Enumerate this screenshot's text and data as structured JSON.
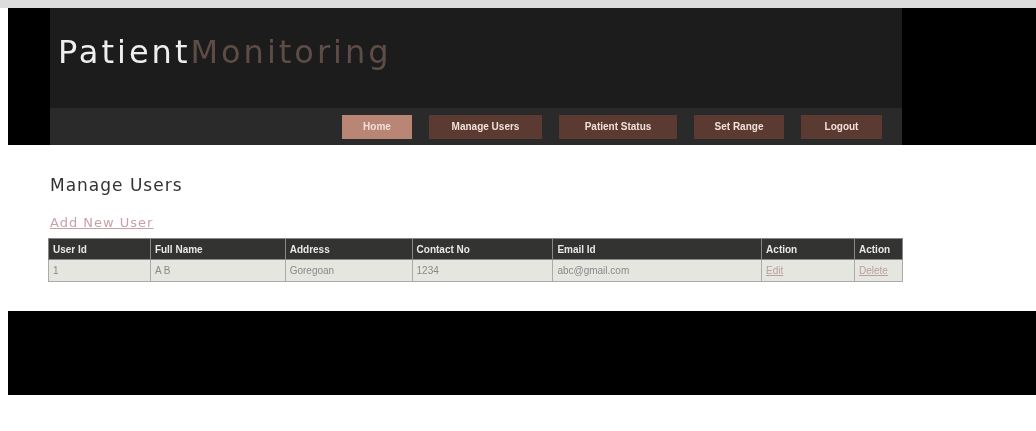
{
  "header": {
    "title_first": "Patient",
    "title_second": "Monitoring"
  },
  "nav": [
    {
      "label": "Home",
      "selected": true
    },
    {
      "label": "Manage Users",
      "selected": false
    },
    {
      "label": "Patient Status",
      "selected": false
    },
    {
      "label": "Set Range",
      "selected": false
    },
    {
      "label": "Logout",
      "selected": false
    }
  ],
  "page": {
    "heading": "Manage Users",
    "add_link": "Add New User"
  },
  "table": {
    "columns": [
      "User Id",
      "Full Name",
      "Address",
      "Contact No",
      "Email Id",
      "Action",
      "Action"
    ],
    "rows": [
      {
        "cells": [
          {
            "text": "1",
            "kind": "text"
          },
          {
            "text": "A B",
            "kind": "text"
          },
          {
            "text": "Goregoan",
            "kind": "text"
          },
          {
            "text": "1234",
            "kind": "text"
          },
          {
            "text": "abc@gmail.com",
            "kind": "text"
          },
          {
            "text": "Edit",
            "kind": "link"
          },
          {
            "text": "Delete",
            "kind": "link"
          }
        ]
      }
    ]
  }
}
